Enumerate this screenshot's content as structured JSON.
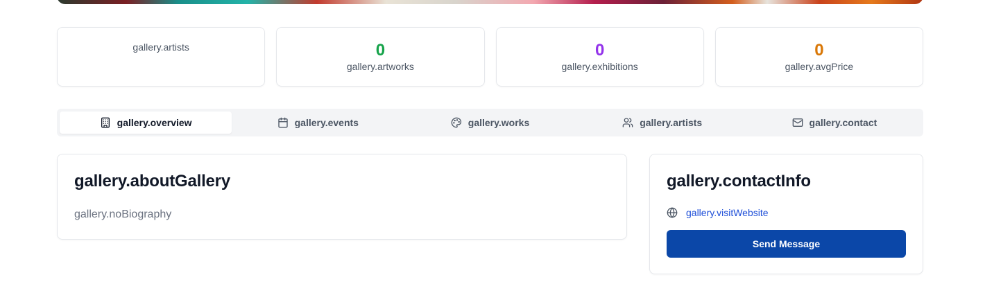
{
  "stats": [
    {
      "label": "gallery.artists",
      "value": ""
    },
    {
      "label": "gallery.artworks",
      "value": "0",
      "color": "#16a34a"
    },
    {
      "label": "gallery.exhibitions",
      "value": "0",
      "color": "#9333ea"
    },
    {
      "label": "gallery.avgPrice",
      "value": "0",
      "color": "#d97706"
    }
  ],
  "tabs": [
    {
      "label": "gallery.overview",
      "icon": "building-icon",
      "active": true
    },
    {
      "label": "gallery.events",
      "icon": "calendar-icon"
    },
    {
      "label": "gallery.works",
      "icon": "palette-icon"
    },
    {
      "label": "gallery.artists",
      "icon": "users-icon"
    },
    {
      "label": "gallery.contact",
      "icon": "mail-icon"
    }
  ],
  "about": {
    "title": "gallery.aboutGallery",
    "body": "gallery.noBiography"
  },
  "contact": {
    "title": "gallery.contactInfo",
    "website_label": "gallery.visitWebsite",
    "website_icon": "globe-icon",
    "send_button": "Send Message"
  },
  "colors": {
    "accent": "#0b47a8",
    "link": "#1d4ed8"
  }
}
